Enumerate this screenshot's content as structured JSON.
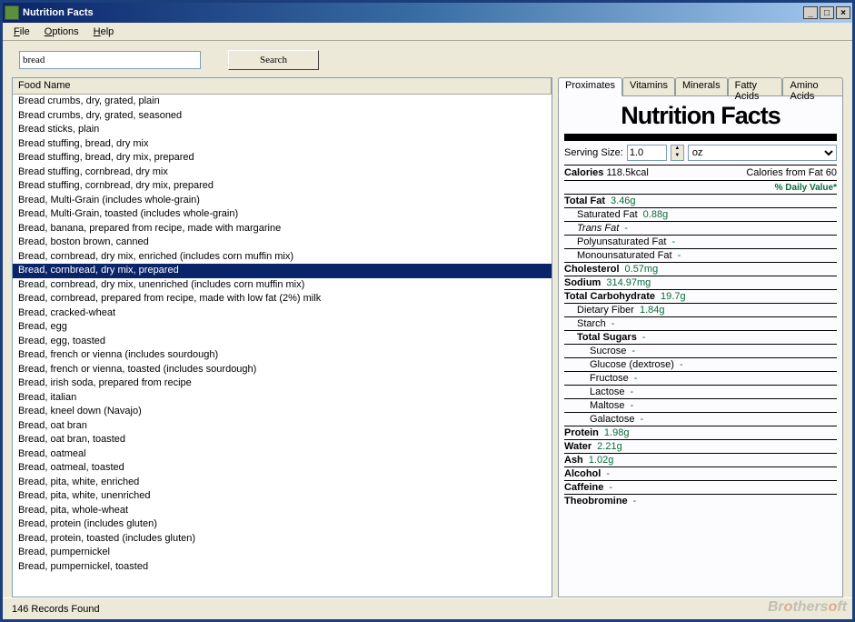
{
  "window": {
    "title": "Nutrition Facts"
  },
  "menu": {
    "file": "File",
    "options": "Options",
    "help": "Help"
  },
  "search": {
    "value": "bread",
    "button": "Search"
  },
  "list": {
    "header": "Food Name",
    "selected_index": 12,
    "items": [
      "Bread crumbs, dry, grated, plain",
      "Bread crumbs, dry, grated, seasoned",
      "Bread sticks, plain",
      "Bread stuffing, bread, dry mix",
      "Bread stuffing, bread, dry mix, prepared",
      "Bread stuffing, cornbread, dry mix",
      "Bread stuffing, cornbread, dry mix, prepared",
      "Bread, Multi-Grain (includes whole-grain)",
      "Bread, Multi-Grain, toasted (includes whole-grain)",
      "Bread, banana, prepared from recipe, made with margarine",
      "Bread, boston brown, canned",
      "Bread, cornbread, dry mix, enriched (includes corn muffin mix)",
      "Bread, cornbread, dry mix, prepared",
      "Bread, cornbread, dry mix, unenriched (includes corn muffin mix)",
      "Bread, cornbread, prepared from recipe, made with low fat (2%) milk",
      "Bread, cracked-wheat",
      "Bread, egg",
      "Bread, egg, toasted",
      "Bread, french or vienna (includes sourdough)",
      "Bread, french or vienna, toasted (includes sourdough)",
      "Bread, irish soda, prepared from recipe",
      "Bread, italian",
      "Bread, kneel down (Navajo)",
      "Bread, oat bran",
      "Bread, oat bran, toasted",
      "Bread, oatmeal",
      "Bread, oatmeal, toasted",
      "Bread, pita, white, enriched",
      "Bread, pita, white, unenriched",
      "Bread, pita, whole-wheat",
      "Bread, protein (includes gluten)",
      "Bread, protein, toasted (includes gluten)",
      "Bread, pumpernickel",
      "Bread, pumpernickel, toasted"
    ]
  },
  "tabs": {
    "t0": "Proximates",
    "t1": "Vitamins",
    "t2": "Minerals",
    "t3": "Fatty Acids",
    "t4": "Amino Acids"
  },
  "facts": {
    "title": "Nutrition Facts",
    "serving_label": "Serving Size:",
    "serving_value": "1.0",
    "unit": "oz",
    "calories_label": "Calories",
    "calories": "118.5kcal",
    "cal_from_fat": "Calories from Fat 60",
    "daily_value": "% Daily Value*",
    "rows": [
      {
        "label": "Total Fat",
        "value": "3.46g",
        "bold": true,
        "indent": 0
      },
      {
        "label": "Saturated Fat",
        "value": "0.88g",
        "bold": false,
        "indent": 1
      },
      {
        "label": "Trans Fat",
        "value": "-",
        "bold": false,
        "indent": 1,
        "italic": true
      },
      {
        "label": "Polyunsaturated Fat",
        "value": "-",
        "bold": false,
        "indent": 1
      },
      {
        "label": "Monounsaturated Fat",
        "value": "-",
        "bold": false,
        "indent": 1
      },
      {
        "label": "Cholesterol",
        "value": "0.57mg",
        "bold": true,
        "indent": 0
      },
      {
        "label": "Sodium",
        "value": "314.97mg",
        "bold": true,
        "indent": 0
      },
      {
        "label": "Total Carbohydrate",
        "value": "19.7g",
        "bold": true,
        "indent": 0
      },
      {
        "label": "Dietary Fiber",
        "value": "1.84g",
        "bold": false,
        "indent": 1
      },
      {
        "label": "Starch",
        "value": "-",
        "bold": false,
        "indent": 1
      },
      {
        "label": "Total Sugars",
        "value": "-",
        "bold": true,
        "indent": 1
      },
      {
        "label": "Sucrose",
        "value": "-",
        "bold": false,
        "indent": 2
      },
      {
        "label": "Glucose (dextrose)",
        "value": "-",
        "bold": false,
        "indent": 2
      },
      {
        "label": "Fructose",
        "value": "-",
        "bold": false,
        "indent": 2
      },
      {
        "label": "Lactose",
        "value": "-",
        "bold": false,
        "indent": 2
      },
      {
        "label": "Maltose",
        "value": "-",
        "bold": false,
        "indent": 2
      },
      {
        "label": "Galactose",
        "value": "-",
        "bold": false,
        "indent": 2
      },
      {
        "label": "Protein",
        "value": "1.98g",
        "bold": true,
        "indent": 0
      },
      {
        "label": "Water",
        "value": "2.21g",
        "bold": true,
        "indent": 0
      },
      {
        "label": "Ash",
        "value": "1.02g",
        "bold": true,
        "indent": 0
      },
      {
        "label": "Alcohol",
        "value": "-",
        "bold": true,
        "indent": 0
      },
      {
        "label": "Caffeine",
        "value": "-",
        "bold": true,
        "indent": 0
      },
      {
        "label": "Theobromine",
        "value": "-",
        "bold": true,
        "indent": 0
      }
    ]
  },
  "status": {
    "text": "146 Records Found"
  },
  "watermark": {
    "a": "Br",
    "b": "o",
    "c": "thers",
    "d": "o",
    "e": "ft"
  }
}
